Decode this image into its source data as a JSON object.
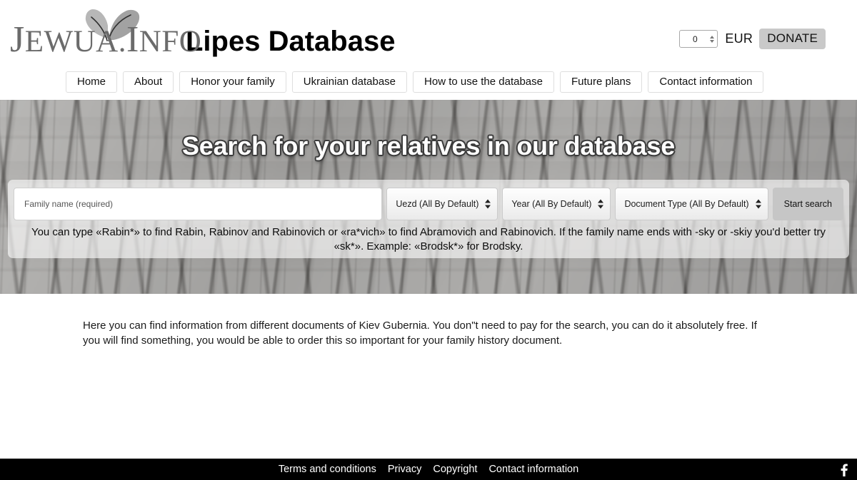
{
  "header": {
    "logo_word_part1": "J",
    "logo_word_part2": "EWUA",
    "logo_word_dot": ".",
    "logo_word_part3": "I",
    "logo_word_part4": "NFO",
    "logo_full": "JEWUA.INFO",
    "site_title": "Lipes Database",
    "donate": {
      "amount": "0",
      "currency": "EUR",
      "button_label": "DONATE",
      "spinner_up_icon": "spinner-up-icon",
      "spinner_down_icon": "spinner-down-icon"
    },
    "leaf_icon": "leaf-logo-icon"
  },
  "nav": {
    "items": [
      {
        "label": "Home"
      },
      {
        "label": "About"
      },
      {
        "label": "Honor your family"
      },
      {
        "label": "Ukrainian database"
      },
      {
        "label": "How to use the database"
      },
      {
        "label": "Future plans"
      },
      {
        "label": "Contact information"
      }
    ]
  },
  "hero": {
    "title": "Search for your relatives in our database",
    "search": {
      "family_name_placeholder": "Family name (required)",
      "family_name_value": "",
      "uezd_selected": "Uezd (All By Default)",
      "year_selected": "Year (All By Default)",
      "doctype_selected": "Document Type (All By Default)",
      "start_button_label": "Start search",
      "hint": "You can type «Rabin*» to find Rabin, Rabinov and Rabinovich or «ra*vich» to find Abramovich and Rabinovich. If the family name ends with -sky or -skiy you'd better try «sk*». Example: «Brodsk*» for Brodsky."
    }
  },
  "main": {
    "intro": "Here you can find information from different documents of Kiev Gubernia. You don\"t need to pay for the search, you can do it absolutely free. If you will find something, you would be able to order this so important for your family history document."
  },
  "footer": {
    "links": [
      {
        "label": "Terms and conditions"
      },
      {
        "label": "Privacy"
      },
      {
        "label": "Copyright"
      },
      {
        "label": "Contact information"
      }
    ],
    "social_icon": "facebook-icon"
  },
  "colors": {
    "donate_button_bg": "#c9c9c9",
    "start_button_bg": "#c6c6c6",
    "footer_bg": "#000000",
    "hero_bg": "#a3a2a0",
    "logo_text": "#6b6b6b"
  }
}
